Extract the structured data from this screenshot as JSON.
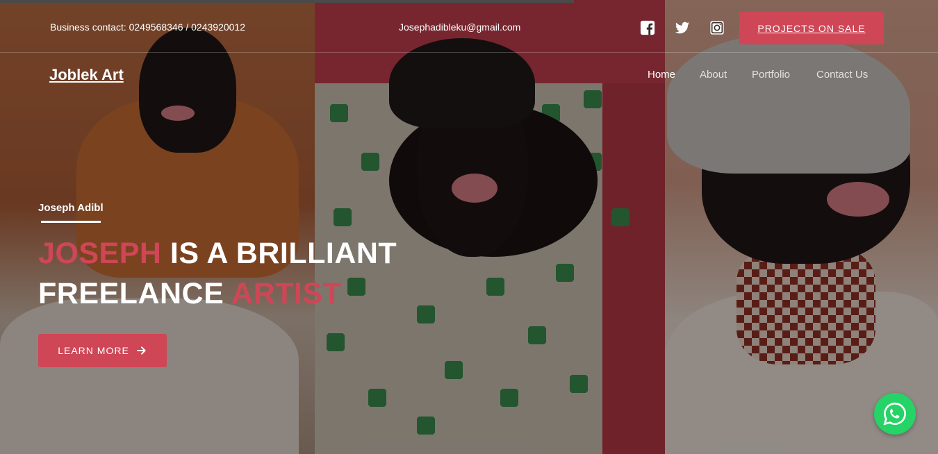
{
  "top_bar": {
    "contact": "Business contact: 0249568346 / 0243920012",
    "email": "Josephadibleku@gmail.com",
    "social": [
      {
        "name": "facebook-icon"
      },
      {
        "name": "twitter-icon"
      },
      {
        "name": "instagram-icon"
      }
    ],
    "projects_button": "PROJECTS ON SALE"
  },
  "nav": {
    "logo": "Joblek Art",
    "items": [
      "Home",
      "About",
      "Portfolio",
      "Contact Us"
    ]
  },
  "hero": {
    "subtitle": "Joseph Adibl",
    "title_part1": "JOSEPH",
    "title_part2": " IS A BRILLIANT",
    "title_part3": "FREELANCE ",
    "title_part4": "ARTIST",
    "cta": "LEARN MORE"
  },
  "colors": {
    "accent": "#cf4657",
    "whatsapp": "#25d366"
  }
}
